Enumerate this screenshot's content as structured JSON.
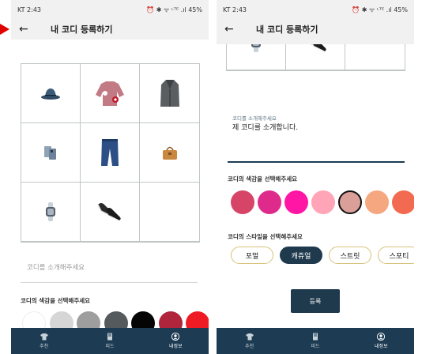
{
  "status": {
    "carrier_time": "KT 2:43",
    "right": "⏰ ✱ ᯤ ᶫᵀᴱ .ıl 45%"
  },
  "appbar": {
    "back_glyph": "←",
    "title": "내 코디 등록하기"
  },
  "grid_icons": [
    "hat-icon",
    "sweater-icon",
    "coat-icon",
    "phone-case-icon",
    "jeans-icon",
    "handbag-icon",
    "watch-icon",
    "sneakers-icon",
    ""
  ],
  "intro": {
    "placeholder": "코디를 소개해주세요",
    "floating_label": "코디를 소개해주세요",
    "value": "제 코디를 소개합니다."
  },
  "color_section": {
    "label": "코디의 색감을 선택해주세요",
    "left_colors": [
      "#ffffff",
      "#d6d6d6",
      "#9e9e9e",
      "#555a5c",
      "#050505",
      "#b0243c",
      "#ee1b24"
    ],
    "right_colors": [
      "#d64568",
      "#de2a8b",
      "#ff16a4",
      "#ffa5b7",
      "#d99f98",
      "#f5a77f",
      "#f26a4f"
    ],
    "right_selected_index": 4
  },
  "style_section": {
    "label": "코디의 스타일을 선택해주세요",
    "chips": [
      "포멀",
      "캐쥬얼",
      "스트릿",
      "스포티"
    ],
    "selected_index": 1
  },
  "submit_label": "등록",
  "bottom_nav": [
    {
      "label": "추천",
      "icon": "tshirt-icon"
    },
    {
      "label": "피드",
      "icon": "feed-icon"
    },
    {
      "label": "내정보",
      "icon": "profile-icon"
    }
  ]
}
